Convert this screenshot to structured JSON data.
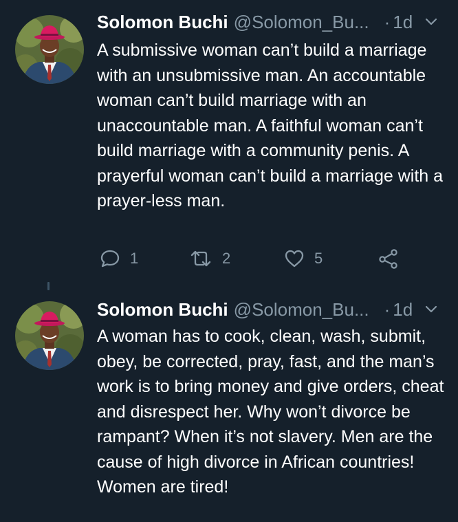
{
  "tweets": [
    {
      "author_name": "Solomon Buchi",
      "author_handle": "@Solomon_Bu...",
      "separator": "·",
      "time": "1d",
      "text": "A submissive woman can’t build a marriage with an unsubmissive man. An accountable woman can’t build marriage with an unaccountable man. A faithful woman can’t build marriage with a community penis. A prayerful woman can’t build a marriage with a prayer-less man.",
      "reply_count": "1",
      "retweet_count": "2",
      "like_count": "5"
    },
    {
      "author_name": "Solomon Buchi",
      "author_handle": "@Solomon_Bu...",
      "separator": "·",
      "time": "1d",
      "text": "A woman has to cook, clean, wash, submit, obey, be corrected, pray, fast, and the man’s work is to bring money and give orders, cheat and disrespect her. Why won’t divorce be rampant? When it’s not slavery. Men are the cause of high divorce in African countries! Women are tired!"
    }
  ],
  "icons": {
    "reply": "reply-icon",
    "retweet": "retweet-icon",
    "like": "heart-icon",
    "share": "share-icon",
    "menu": "chevron-down-icon"
  },
  "colors": {
    "background": "#15202b",
    "text_primary": "#ffffff",
    "text_secondary": "#8899a6",
    "thread_line": "#3d5466"
  }
}
